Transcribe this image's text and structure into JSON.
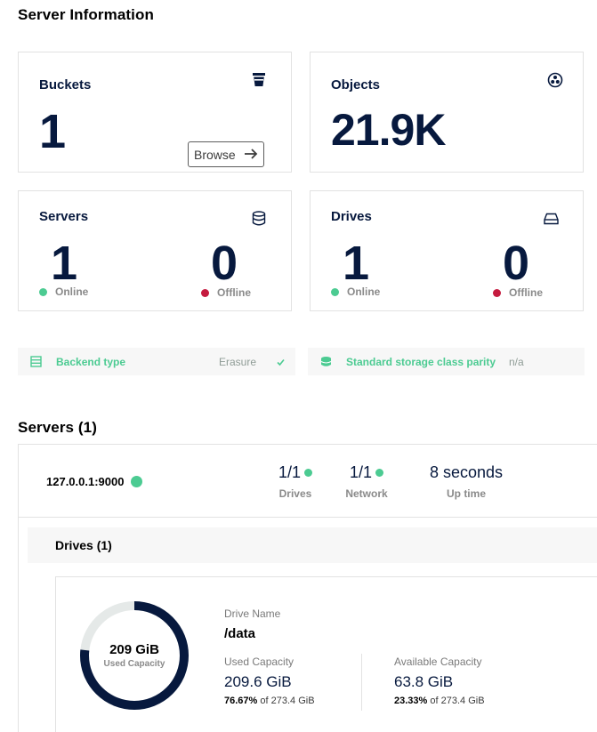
{
  "page_title": "Server Information",
  "cards": {
    "buckets": {
      "title": "Buckets",
      "value": "1",
      "icon": "bucket-icon",
      "browse_label": "Browse"
    },
    "objects": {
      "title": "Objects",
      "value": "21.9K",
      "icon": "objects-icon"
    },
    "servers": {
      "title": "Servers",
      "online_value": "1",
      "online_label": "Online",
      "offline_value": "0",
      "offline_label": "Offline",
      "icon": "servers-icon"
    },
    "drives": {
      "title": "Drives",
      "online_value": "1",
      "online_label": "Online",
      "offline_value": "0",
      "offline_label": "Offline",
      "icon": "drive-icon"
    }
  },
  "info_bar": {
    "backend_label": "Backend type",
    "backend_value": "Erasure",
    "parity_label": "Standard storage class parity",
    "parity_value": "n/a"
  },
  "servers_section": {
    "title": "Servers (1)",
    "server": {
      "endpoint": "127.0.0.1:9000",
      "drives_value": "1/1",
      "drives_label": "Drives",
      "network_value": "1/1",
      "network_label": "Network",
      "uptime_value": "8 seconds",
      "uptime_label": "Up time"
    },
    "drives_header": "Drives (1)",
    "drive": {
      "capacity_center": "209 GiB",
      "capacity_center_label": "Used Capacity",
      "used_fraction": 0.7667,
      "name_label": "Drive Name",
      "name": "/data",
      "used_label": "Used Capacity",
      "used_value": "209.6 GiB",
      "used_pct": "76.67%",
      "used_of": "of 273.4 GiB",
      "avail_label": "Available Capacity",
      "avail_value": "63.8 GiB",
      "avail_pct": "23.33%",
      "avail_of": "of 273.4 GiB"
    }
  },
  "colors": {
    "navy": "#07193e",
    "online": "#4ccb92",
    "offline": "#c51b3f",
    "donut_track": "#e5e9e8"
  }
}
